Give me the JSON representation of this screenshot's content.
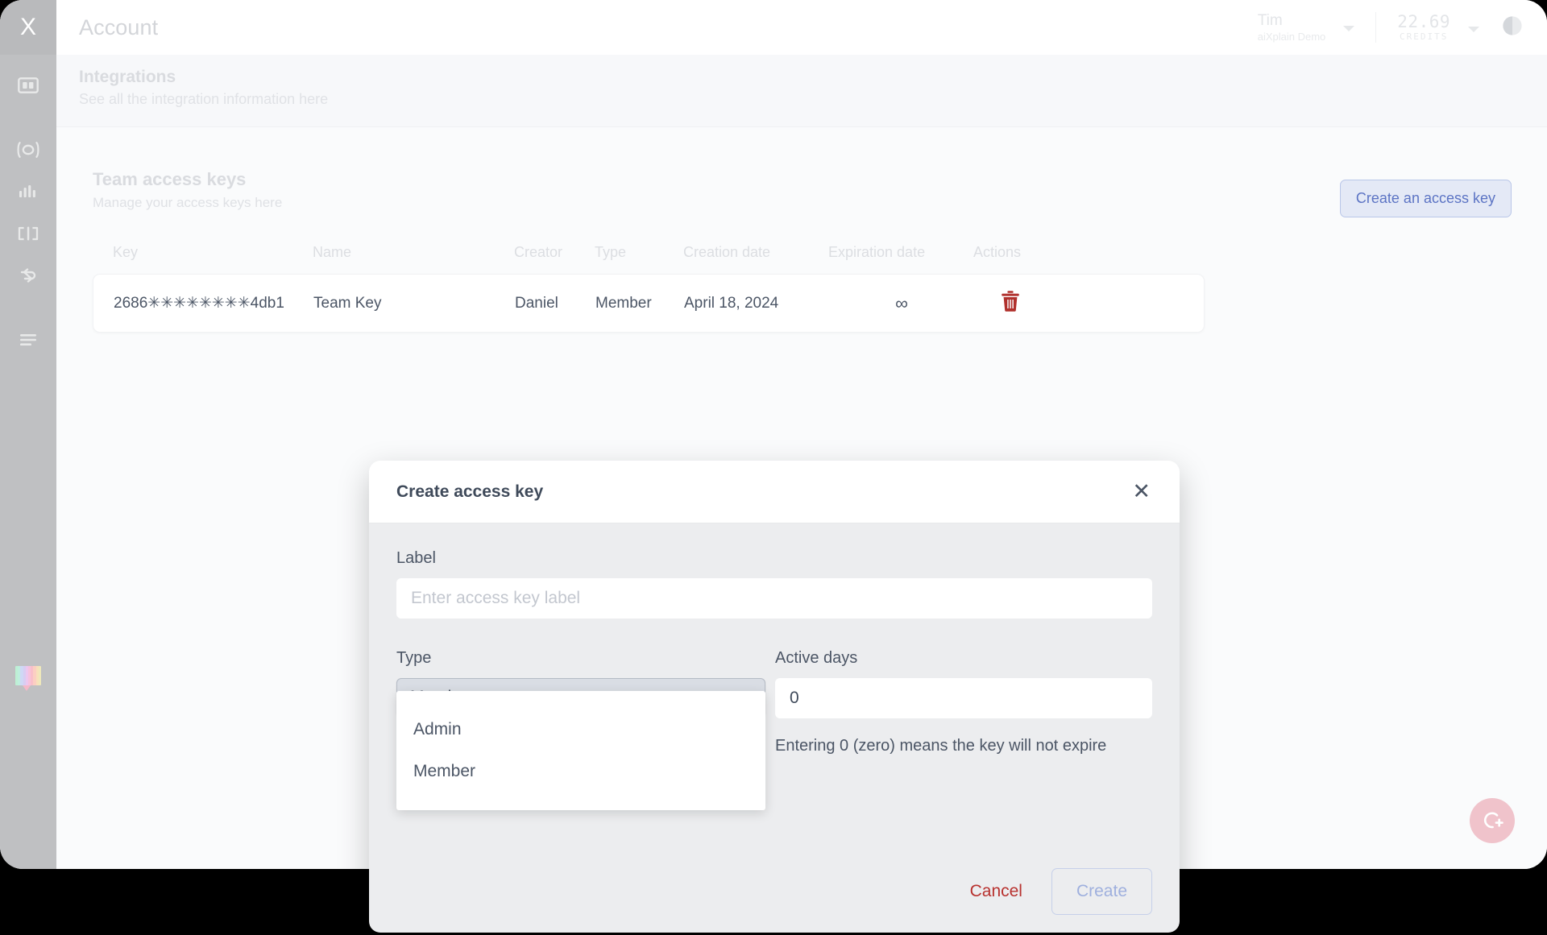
{
  "sidebar": {
    "logo": "X",
    "items": [
      {
        "name": "dashboard-icon",
        "label": "Dashboard"
      },
      {
        "name": "discover-icon",
        "label": "Discover"
      },
      {
        "name": "metrics-icon",
        "label": "Metrics"
      },
      {
        "name": "benchmark-icon",
        "label": "Benchmark"
      },
      {
        "name": "pipelines-icon",
        "label": "Pipelines"
      },
      {
        "name": "menu-icon",
        "label": "Menu"
      }
    ],
    "chat_icon_label": "Chat"
  },
  "header": {
    "page_title": "Account",
    "account_name": "Tim",
    "account_org": "aiXplain Demo",
    "credits_value": "22.69",
    "credits_label": "CREDITS",
    "theme_toggle_label": "Toggle theme"
  },
  "subheader": {
    "title": "Integrations",
    "description": "See all the integration information here"
  },
  "section": {
    "title": "Team access keys",
    "description": "Manage your access keys here",
    "create_button": "Create an access key"
  },
  "table": {
    "columns": [
      "Key",
      "Name",
      "Creator",
      "Type",
      "Creation date",
      "Expiration date",
      "Actions"
    ],
    "rows": [
      {
        "key": "2686✳✳✳✳✳✳✳✳4db1",
        "name": "Team Key",
        "creator": "Daniel",
        "type": "Member",
        "creation_date": "April 18, 2024",
        "expiration_date": "∞",
        "action": "delete"
      }
    ]
  },
  "fab": {
    "label": "Create new"
  },
  "modal": {
    "title": "Create access key",
    "close_label": "✕",
    "label_field": {
      "label": "Label",
      "value": "",
      "placeholder": "Enter access key label"
    },
    "type_field": {
      "label": "Type",
      "selected": "Member",
      "options": [
        "Admin",
        "Member"
      ],
      "open": true
    },
    "days_field": {
      "label": "Active days",
      "value": "0",
      "hint": "Entering 0 (zero) means the key will not expire"
    },
    "cancel_button": "Cancel",
    "create_button": "Create"
  },
  "colors": {
    "sidebar": "#bfc0c2",
    "page_bg": "#fafbfc",
    "modal_bg": "#ecedef",
    "accent_blue": "#5c74c4",
    "danger_red": "#b8322f",
    "trash_red": "#b0302c",
    "fab_pink": "#f0c3cb"
  }
}
